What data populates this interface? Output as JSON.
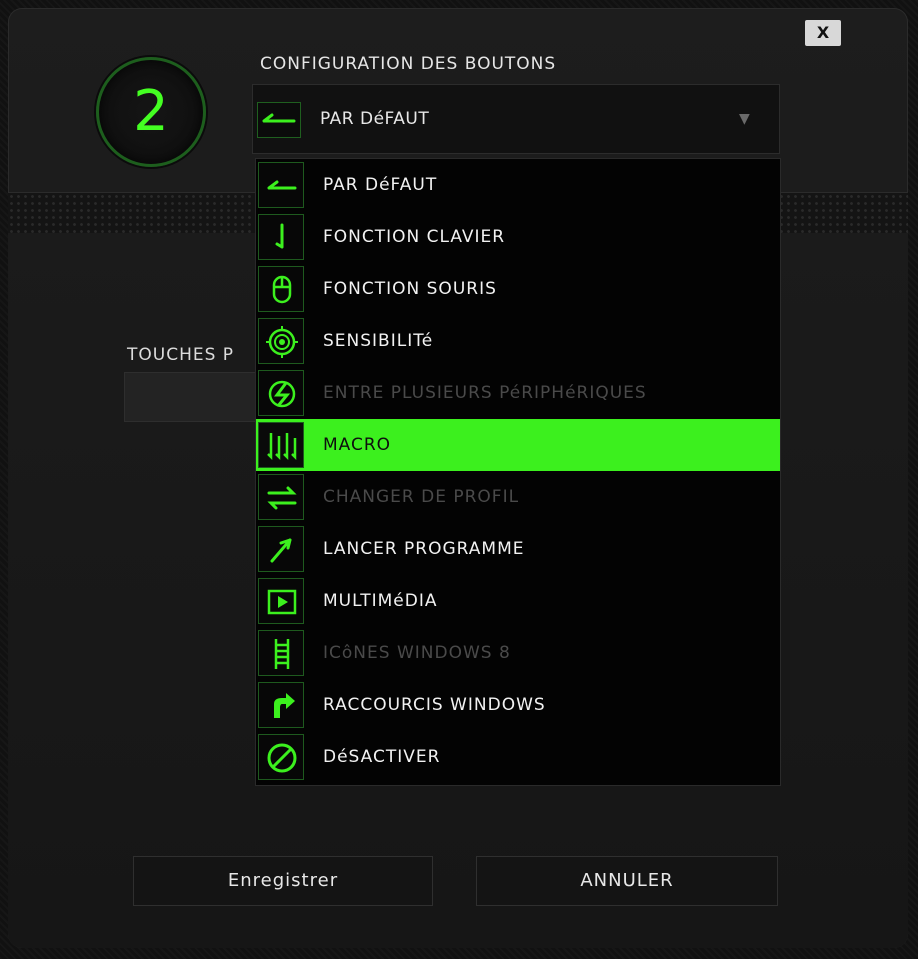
{
  "close_label": "X",
  "button_number": "2",
  "section_title": "CONFIGURATION DES BOUTONS",
  "selected": {
    "label": "PAR DéFAUT",
    "icon": "default-arrow-icon"
  },
  "touches_label": "TOUCHES P",
  "menu_items": [
    {
      "label": "PAR DéFAUT",
      "icon": "default-arrow-icon",
      "state": "normal"
    },
    {
      "label": "FONCTION CLAVIER",
      "icon": "keyboard-function-icon",
      "state": "normal"
    },
    {
      "label": "FONCTION SOURIS",
      "icon": "mouse-icon",
      "state": "normal"
    },
    {
      "label": "SENSIBILITé",
      "icon": "sensitivity-target-icon",
      "state": "normal"
    },
    {
      "label": "ENTRE PLUSIEURS PéRIPHéRIQUES",
      "icon": "inter-device-icon",
      "state": "disabled"
    },
    {
      "label": "MACRO",
      "icon": "macro-icon",
      "state": "active"
    },
    {
      "label": "CHANGER DE PROFIL",
      "icon": "switch-profile-icon",
      "state": "disabled"
    },
    {
      "label": "LANCER PROGRAMME",
      "icon": "launch-program-icon",
      "state": "normal"
    },
    {
      "label": "MULTIMéDIA",
      "icon": "multimedia-play-icon",
      "state": "normal"
    },
    {
      "label": "ICôNES WINDOWS 8",
      "icon": "windows8-icon",
      "state": "disabled"
    },
    {
      "label": "RACCOURCIS WINDOWS",
      "icon": "windows-shortcut-icon",
      "state": "normal"
    },
    {
      "label": "DéSACTIVER",
      "icon": "disable-icon",
      "state": "normal"
    }
  ],
  "buttons": {
    "save": "Enregistrer",
    "cancel": "ANNULER"
  },
  "colors": {
    "accent": "#3cf01e",
    "icon_green": "#3cf01e",
    "icon_border": "#1e5a1e"
  }
}
